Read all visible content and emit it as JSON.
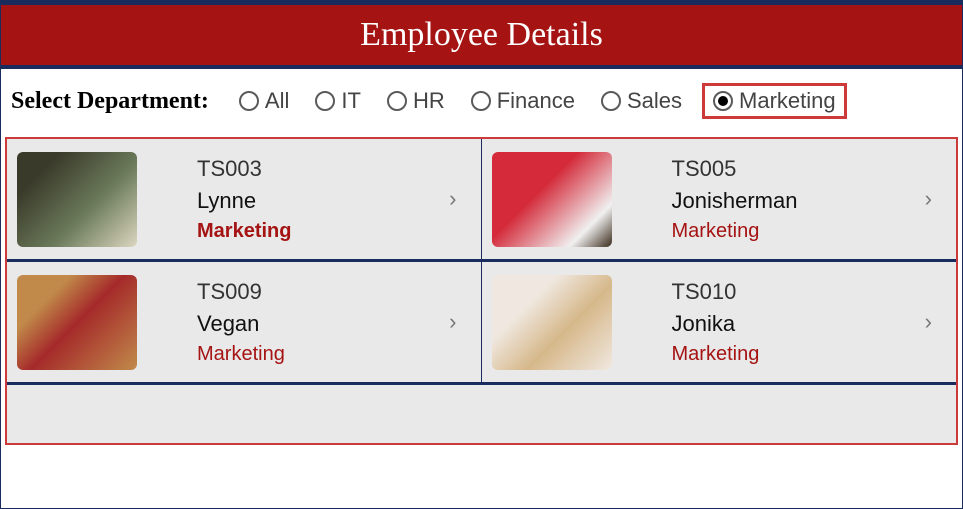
{
  "header": {
    "title": "Employee Details"
  },
  "filter": {
    "label": "Select Department:",
    "options": [
      {
        "label": "All",
        "selected": false
      },
      {
        "label": "IT",
        "selected": false
      },
      {
        "label": "HR",
        "selected": false
      },
      {
        "label": "Finance",
        "selected": false
      },
      {
        "label": "Sales",
        "selected": false
      },
      {
        "label": "Marketing",
        "selected": true
      }
    ]
  },
  "employees": [
    {
      "id": "TS003",
      "name": "Lynne",
      "dept": "Marketing",
      "dept_bold": true
    },
    {
      "id": "TS005",
      "name": "Jonisherman",
      "dept": "Marketing",
      "dept_bold": false
    },
    {
      "id": "TS009",
      "name": "Vegan",
      "dept": "Marketing",
      "dept_bold": false
    },
    {
      "id": "TS010",
      "name": "Jonika",
      "dept": "Marketing",
      "dept_bold": false
    }
  ]
}
